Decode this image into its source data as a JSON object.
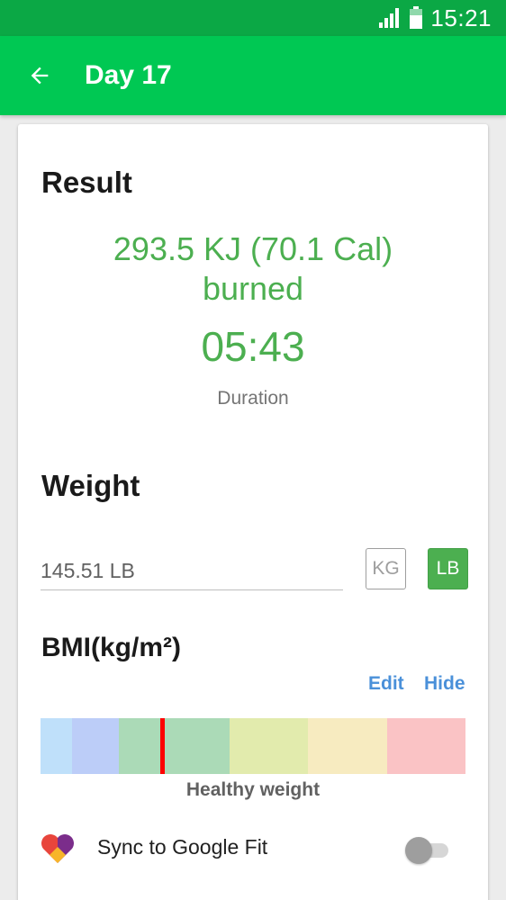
{
  "status_bar": {
    "time": "15:21",
    "icons": [
      "signal-icon",
      "battery-icon"
    ]
  },
  "app_bar": {
    "back_icon": "arrow-left-icon",
    "title": "Day 17"
  },
  "result": {
    "title": "Result",
    "energy": "293.5 KJ (70.1 Cal)",
    "burned_label": "burned",
    "duration_value": "05:43",
    "duration_label": "Duration"
  },
  "weight": {
    "title": "Weight",
    "value": "145.51 LB",
    "unit_kg": "KG",
    "unit_lb": "LB",
    "selected_unit": "LB"
  },
  "bmi": {
    "title": "BMI(kg/m²)",
    "edit_label": "Edit",
    "hide_label": "Hide",
    "category_label": "Healthy weight",
    "segment_colors": [
      "#bfe0fa",
      "#bccdf8",
      "#abdab7",
      "#abdab7",
      "#e2ebad",
      "#f7ebc0",
      "#fac3c5"
    ]
  },
  "google_fit": {
    "label": "Sync to Google Fit",
    "enabled": false,
    "icon": "google-fit-heart-icon"
  },
  "colors": {
    "primary": "#00c853",
    "status_bar": "#0ba845",
    "accent_green": "#4caf50",
    "link_blue": "#4a90d9"
  }
}
